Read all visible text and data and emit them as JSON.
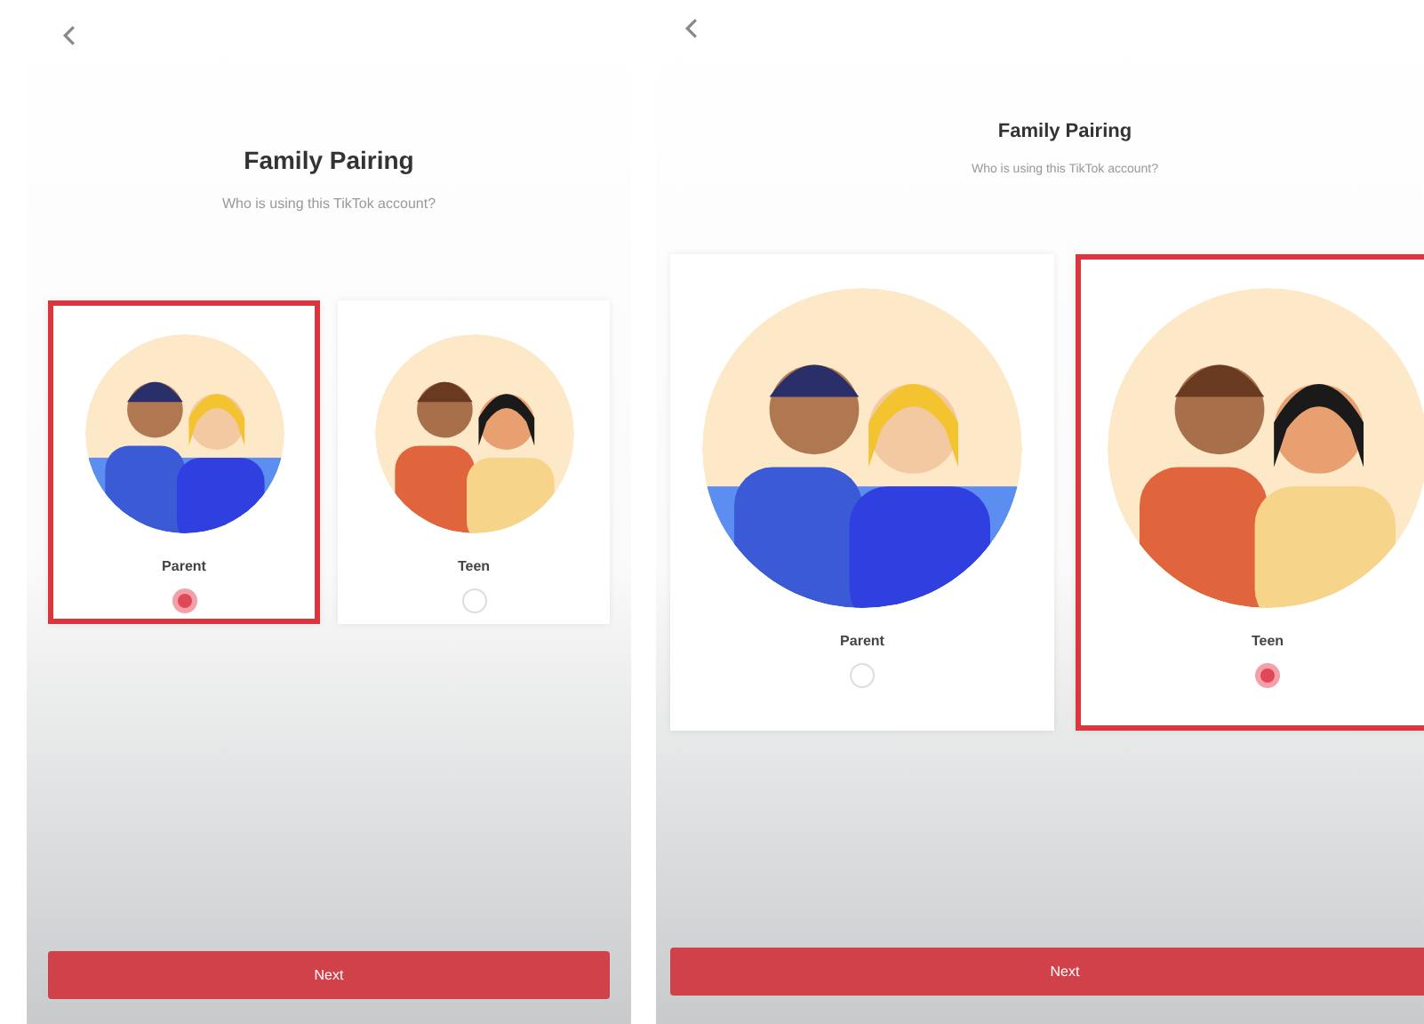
{
  "screens": [
    {
      "title": "Family Pairing",
      "subtitle": "Who is using this TikTok account?",
      "options": [
        {
          "label": "Parent",
          "kind": "parent",
          "selected": true
        },
        {
          "label": "Teen",
          "kind": "teen",
          "selected": false
        }
      ],
      "button": "Next"
    },
    {
      "title": "Family Pairing",
      "subtitle": "Who is using this TikTok account?",
      "options": [
        {
          "label": "Parent",
          "kind": "parent",
          "selected": false
        },
        {
          "label": "Teen",
          "kind": "teen",
          "selected": true
        }
      ],
      "button": "Next"
    }
  ]
}
